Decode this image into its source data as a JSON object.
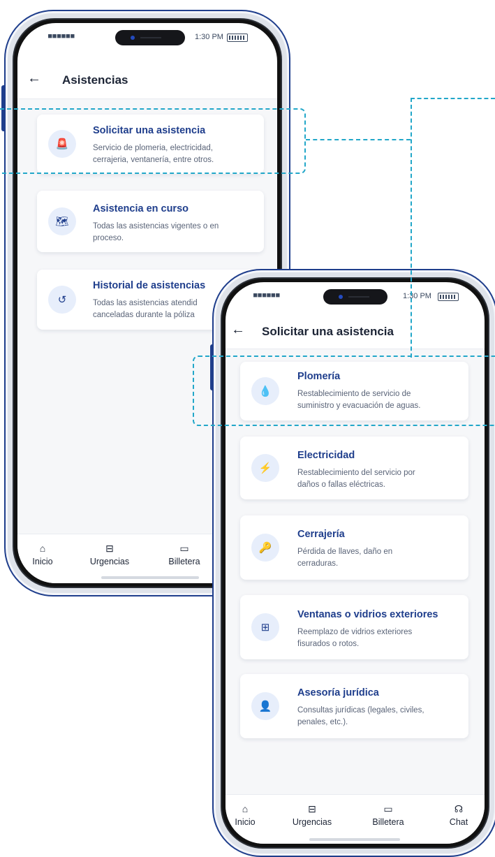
{
  "status_bar": {
    "signal": "■■■■■■",
    "time": "1:30 PM"
  },
  "screen_one": {
    "title": "Asistencias",
    "cards": [
      {
        "title": "Solicitar una asistencia",
        "desc_line1": "Servicio de plomeria, electricidad,",
        "desc_line2": "cerrajeria, ventanería, entre otros.",
        "icon": "alarm-icon",
        "glyph": "🚨"
      },
      {
        "title": "Asistencia en curso",
        "desc_line1": "Todas las asistencias vigentes o en",
        "desc_line2": "proceso.",
        "icon": "map-icon",
        "glyph": "🗺"
      },
      {
        "title": "Historial de asistencias",
        "desc_line1": "Todas las asistencias atendid",
        "desc_line2": "canceladas durante la póliza",
        "icon": "history-icon",
        "glyph": "↺"
      }
    ]
  },
  "screen_two": {
    "title": "Solicitar una asistencia",
    "cards": [
      {
        "title": "Plomería",
        "desc_line1": "Restablecimiento de servicio de",
        "desc_line2": "suministro y evacuación de aguas.",
        "icon": "water-drop-icon",
        "glyph": "💧"
      },
      {
        "title": "Electricidad",
        "desc_line1": "Restablecimiento del servicio por",
        "desc_line2": "daños o fallas eléctricas.",
        "icon": "lightning-icon",
        "glyph": "⚡"
      },
      {
        "title": "Cerrajería",
        "desc_line1": "Pérdida de llaves, daño en",
        "desc_line2": "cerraduras.",
        "icon": "key-icon",
        "glyph": "🔑"
      },
      {
        "title": "Ventanas o vidrios exteriores",
        "desc_line1": "Reemplazo de vidrios exteriores",
        "desc_line2": "fisurados o rotos.",
        "icon": "window-icon",
        "glyph": "⊞"
      },
      {
        "title": "Asesoría jurídica",
        "desc_line1": "Consultas jurídicas (legales, civiles,",
        "desc_line2": "penales, etc.).",
        "icon": "advisor-icon",
        "glyph": "👤"
      }
    ]
  },
  "tab_bar": {
    "home": "Inicio",
    "urgent": "Urgencias",
    "wallet": "Billetera",
    "chat": "Chat"
  },
  "colors": {
    "accent": "#1f3e8c",
    "icon_bg": "#e7eefb",
    "connector": "#22a7c9"
  }
}
